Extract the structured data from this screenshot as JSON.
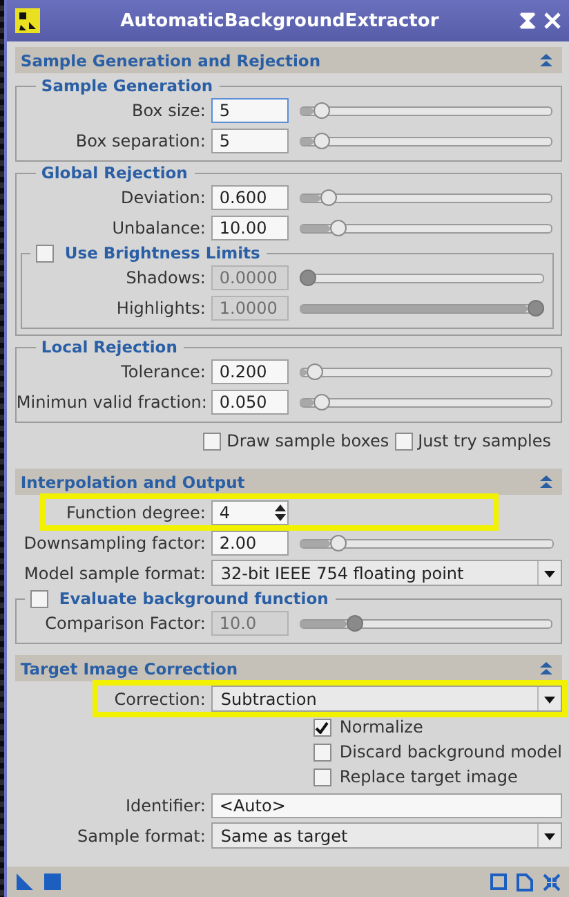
{
  "window": {
    "title": "AutomaticBackgroundExtractor"
  },
  "sections": [
    {
      "title": "Sample Generation and Rejection",
      "content": [
        {
          "kind": "group",
          "title": "Sample Generation",
          "rows": [
            {
              "kind": "slider",
              "label": "Box size:",
              "value": "5",
              "level": 0.06,
              "disabled": false,
              "focused": true
            },
            {
              "kind": "slider",
              "label": "Box separation:",
              "value": "5",
              "level": 0.06,
              "disabled": false,
              "focused": false
            }
          ]
        },
        {
          "kind": "group",
          "title": "Global Rejection",
          "rows": [
            {
              "kind": "slider",
              "label": "Deviation:",
              "value": "0.600",
              "level": 0.09,
              "disabled": false,
              "focused": false
            },
            {
              "kind": "slider",
              "label": "Unbalance:",
              "value": "10.00",
              "level": 0.13,
              "disabled": false,
              "focused": false
            },
            {
              "kind": "group",
              "title": "Use Brightness Limits",
              "checked": false,
              "rows": [
                {
                  "kind": "slider",
                  "label": "Shadows:",
                  "value": "0.0000",
                  "level": 0.0,
                  "disabled": true,
                  "focused": false
                },
                {
                  "kind": "slider",
                  "label": "Highlights:",
                  "value": "1.0000",
                  "level": 1.0,
                  "disabled": true,
                  "focused": false
                }
              ]
            }
          ]
        },
        {
          "kind": "group",
          "title": "Local Rejection",
          "rows": [
            {
              "kind": "slider",
              "label": "Tolerance:",
              "value": "0.200",
              "level": 0.03,
              "disabled": false,
              "focused": false
            },
            {
              "kind": "slider",
              "label": "Minimun valid fraction:",
              "value": "0.050",
              "level": 0.06,
              "disabled": false,
              "focused": false
            }
          ]
        },
        {
          "kind": "checks",
          "inline": true,
          "items": [
            {
              "label": "Draw sample boxes",
              "checked": false
            },
            {
              "label": "Just try samples",
              "checked": false
            }
          ]
        }
      ]
    },
    {
      "title": "Interpolation and Output",
      "content": [
        {
          "kind": "spin",
          "label": "Function degree:",
          "value": "4",
          "highlighted": true
        },
        {
          "kind": "slider",
          "label": "Downsampling factor:",
          "value": "2.00",
          "level": 0.13,
          "disabled": false,
          "focused": false
        },
        {
          "kind": "select",
          "label": "Model sample format:",
          "value": "32-bit IEEE 754 floating point",
          "highlighted": false
        },
        {
          "kind": "group",
          "title": "Evaluate background function",
          "checked": false,
          "rows": [
            {
              "kind": "slider",
              "label": "Comparison Factor:",
              "value": "10.0",
              "level": 0.2,
              "disabled": true,
              "focused": false
            }
          ]
        }
      ]
    },
    {
      "title": "Target Image Correction",
      "content": [
        {
          "kind": "select",
          "label": "Correction:",
          "value": "Subtraction",
          "highlighted": true
        },
        {
          "kind": "checks",
          "inline": false,
          "items": [
            {
              "label": "Normalize",
              "checked": true
            },
            {
              "label": "Discard background model",
              "checked": false
            },
            {
              "label": "Replace target image",
              "checked": false
            }
          ]
        },
        {
          "kind": "text",
          "label": "Identifier:",
          "value": "<Auto>"
        },
        {
          "kind": "select",
          "label": "Sample format:",
          "value": "Same as target",
          "highlighted": false
        }
      ]
    }
  ]
}
